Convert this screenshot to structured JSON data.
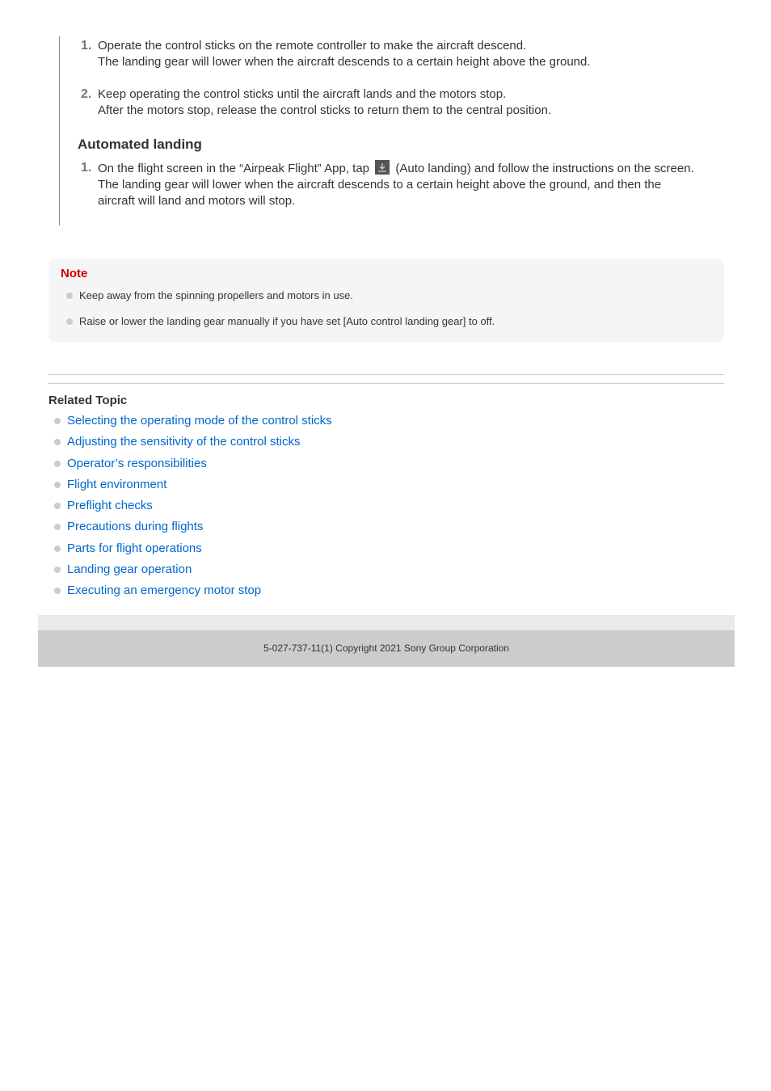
{
  "manual_landing": {
    "steps": [
      {
        "num": "1.",
        "line1": "Operate the control sticks on the remote controller to make the aircraft descend.",
        "line2": "The landing gear will lower when the aircraft descends to a certain height above the ground."
      },
      {
        "num": "2.",
        "line1": "Keep operating the control sticks until the aircraft lands and the motors stop.",
        "line2": "After the motors stop, release the control sticks to return them to the central position."
      }
    ]
  },
  "automated_landing": {
    "heading": "Automated landing",
    "steps": [
      {
        "num": "1.",
        "line1_before": "On the flight screen in the “Airpeak Flight” App, tap",
        "icon": "auto-landing-icon",
        "line1_after": "(Auto landing) and follow the instructions on the screen.",
        "line2": "The landing gear will lower when the aircraft descends to a certain height above the ground, and then the",
        "line3": "aircraft will land and motors will stop."
      }
    ]
  },
  "note": {
    "title": "Note",
    "items": [
      "Keep away from the spinning propellers and motors in use.",
      "Raise or lower the landing gear manually if you have set [Auto control landing gear] to off."
    ],
    "title_color": "#cc0000"
  },
  "related": {
    "title": "Related Topic",
    "links": [
      "Selecting the operating mode of the control sticks",
      "Adjusting the sensitivity of the control sticks",
      "Operator’s responsibilities",
      "Flight environment",
      "Preflight checks",
      "Precautions during flights",
      "Parts for flight operations",
      "Landing gear operation",
      "Executing an emergency motor stop"
    ],
    "link_color": "#0066cc"
  },
  "footer": {
    "copyright": "5-027-737-11(1) Copyright 2021 Sony Group Corporation"
  }
}
